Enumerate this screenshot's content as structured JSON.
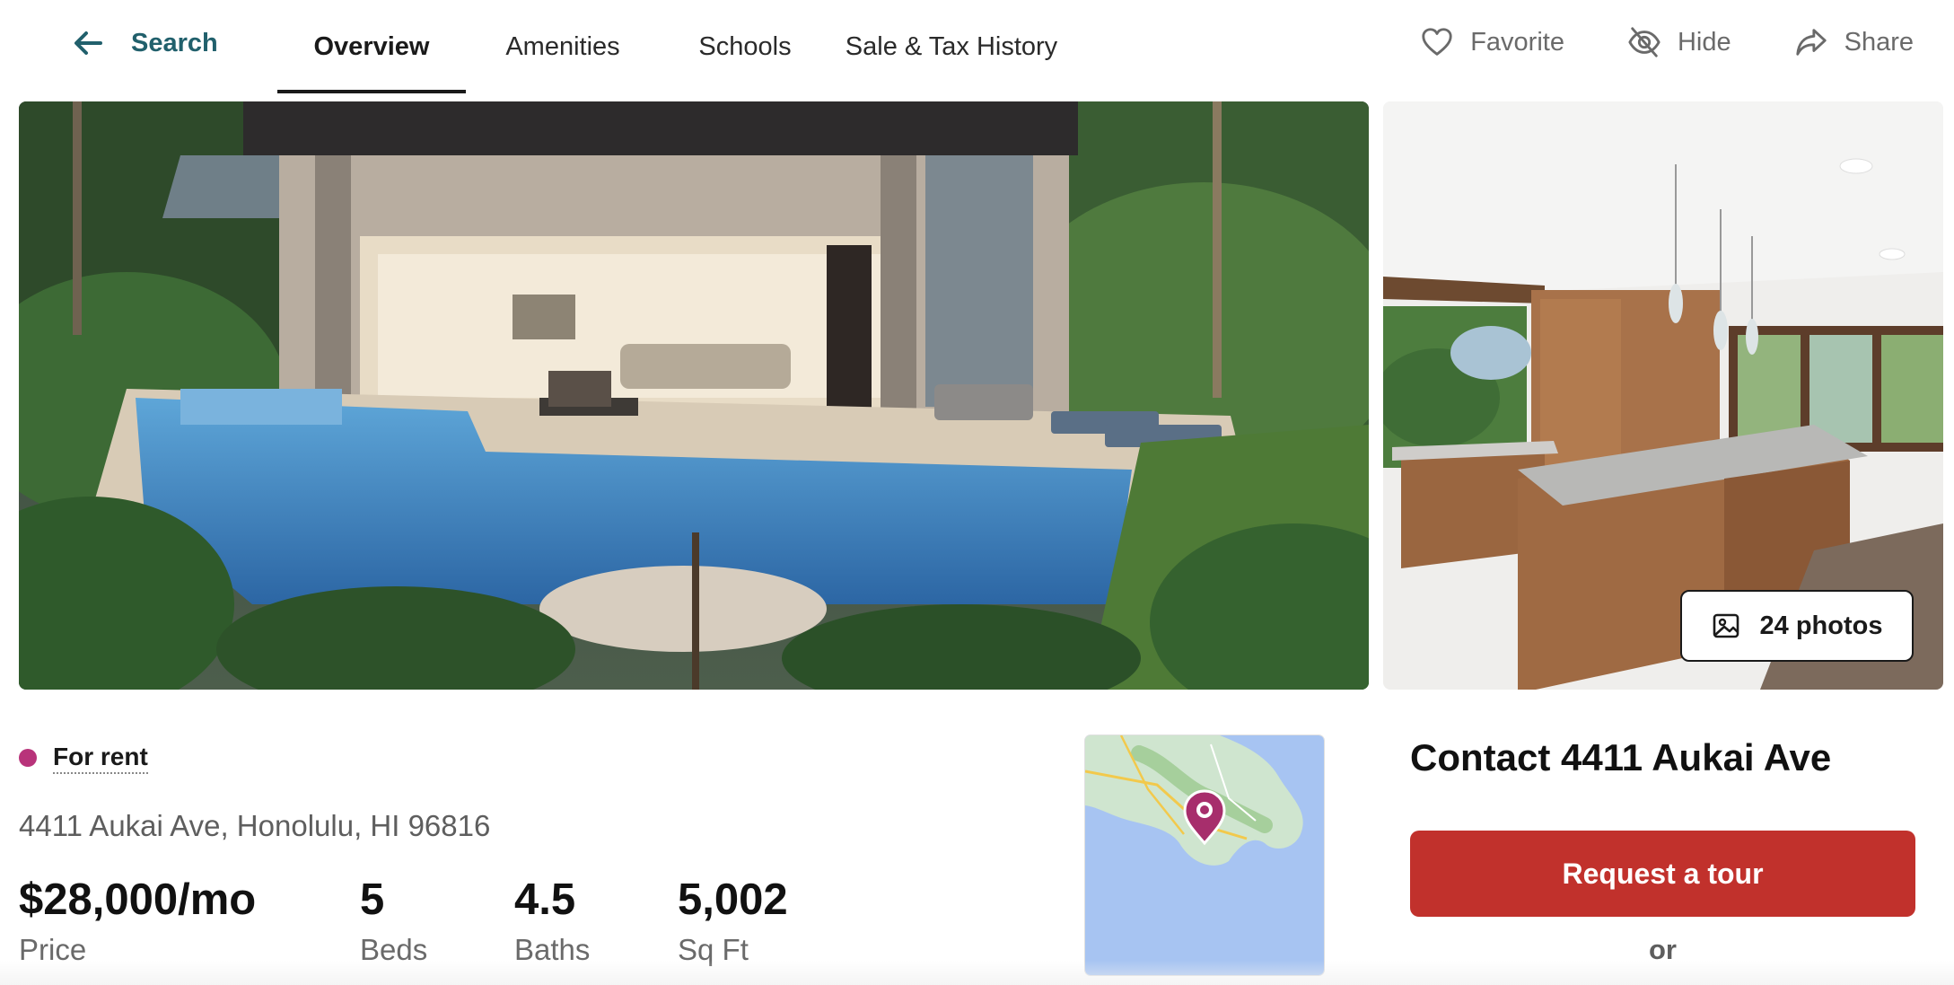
{
  "nav": {
    "back_label": "Search",
    "back_icon": "arrow-left-icon",
    "tabs": [
      {
        "label": "Overview",
        "active": true
      },
      {
        "label": "Amenities",
        "active": false
      },
      {
        "label": "Schools",
        "active": false
      },
      {
        "label": "Sale & Tax History",
        "active": false
      }
    ],
    "actions": [
      {
        "label": "Favorite",
        "icon": "heart-icon"
      },
      {
        "label": "Hide",
        "icon": "eye-off-icon"
      },
      {
        "label": "Share",
        "icon": "share-icon"
      }
    ]
  },
  "gallery": {
    "photos_button_label": "24 photos",
    "photos_icon": "image-icon"
  },
  "listing": {
    "status": "For rent",
    "status_color": "#b8337a",
    "address": "4411 Aukai Ave, Honolulu, HI 96816",
    "stats": [
      {
        "value": "$28,000/mo",
        "label": "Price"
      },
      {
        "value": "5",
        "label": "Beds"
      },
      {
        "value": "4.5",
        "label": "Baths"
      },
      {
        "value": "5,002",
        "label": "Sq Ft"
      }
    ]
  },
  "map": {
    "marker_icon": "map-pin-icon",
    "marker_color": "#a72e6c"
  },
  "contact": {
    "title": "Contact 4411 Aukai Ave",
    "tour_button": "Request a tour",
    "tour_button_color": "#c1312c",
    "or_text": "or"
  },
  "colors": {
    "accent": "#21606c"
  }
}
